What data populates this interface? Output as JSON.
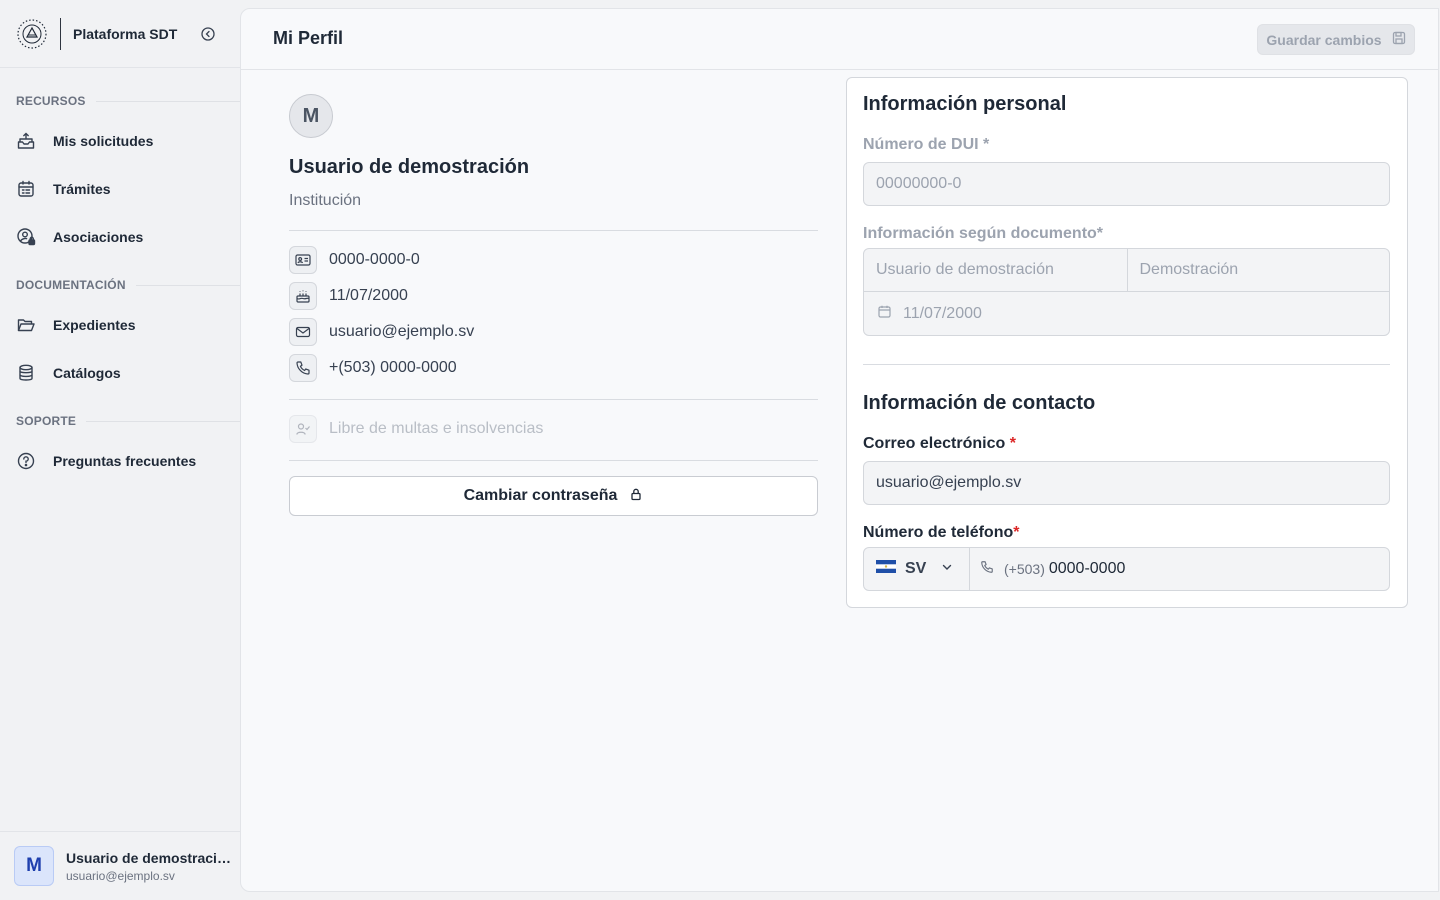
{
  "sidebar": {
    "brand": "Plataforma SDT",
    "sections": [
      {
        "title": "RECURSOS",
        "items": [
          {
            "label": "Mis solicitudes",
            "icon": "inbox-upload-icon"
          },
          {
            "label": "Trámites",
            "icon": "calendar-list-icon"
          },
          {
            "label": "Asociaciones",
            "icon": "user-lock-icon"
          }
        ]
      },
      {
        "title": "DOCUMENTACIÓN",
        "items": [
          {
            "label": "Expedientes",
            "icon": "folder-open-icon"
          },
          {
            "label": "Catálogos",
            "icon": "database-icon"
          }
        ]
      },
      {
        "title": "SOPORTE",
        "items": [
          {
            "label": "Preguntas frecuentes",
            "icon": "help-circle-icon"
          }
        ]
      }
    ],
    "user": {
      "initial": "M",
      "name": "Usuario de demostración",
      "email": "usuario@ejemplo.sv"
    }
  },
  "header": {
    "title": "Mi Perfil",
    "save_label": "Guardar cambios"
  },
  "profile": {
    "initial": "M",
    "name": "Usuario de demostración",
    "institution": "Institución",
    "dui": "0000-0000-0",
    "birthdate": "11/07/2000",
    "email": "usuario@ejemplo.sv",
    "phone": "+(503) 0000-0000",
    "status": "Libre de multas e insolvencias",
    "change_password": "Cambiar contraseña"
  },
  "form": {
    "personal_title": "Información personal",
    "dui_label": "Número de DUI",
    "dui_req": "*",
    "dui_placeholder": "00000000-0",
    "doc_label": "Información según documento",
    "doc_req": "*",
    "doc_name": "Usuario de demostración",
    "doc_lastname": "Demostración",
    "doc_date": "11/07/2000",
    "contact_title": "Información de contacto",
    "email_label": "Correo electrónico",
    "email_req": "*",
    "email_value": "usuario@ejemplo.sv",
    "phone_label": "Número de teléfono",
    "phone_req": "*",
    "country_code": "SV",
    "phone_prefix": "(+503)",
    "phone_value": "0000-0000"
  },
  "colors": {
    "accent": "#1e3fae",
    "required": "#dc2626",
    "flag_blue": "#1f4fa8"
  }
}
